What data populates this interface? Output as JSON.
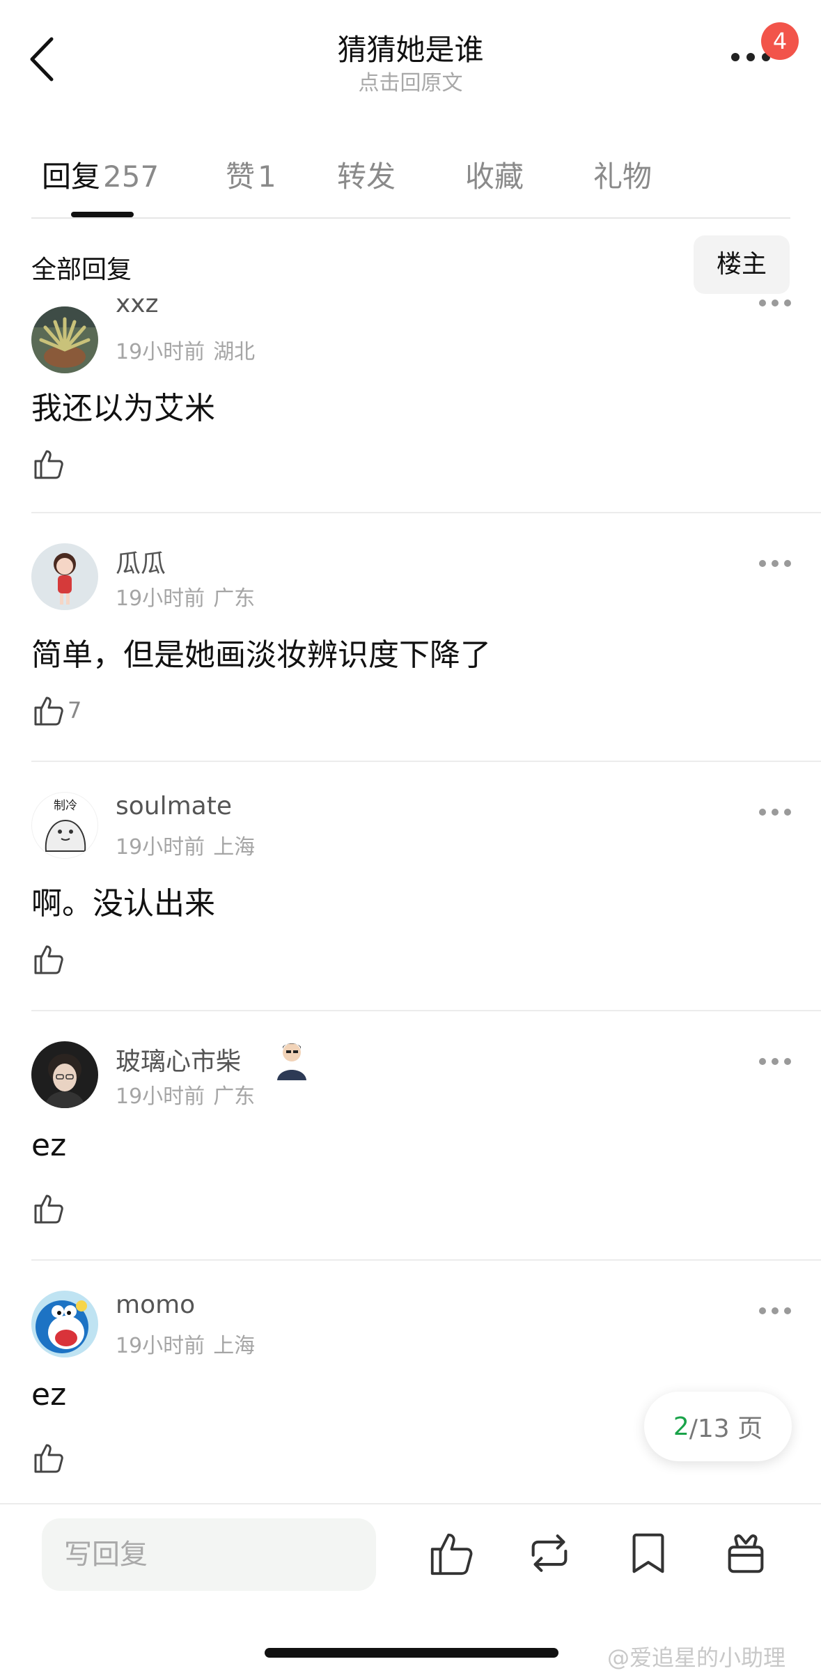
{
  "header": {
    "title": "猜猜她是谁",
    "subtitle": "点击回原文",
    "notification_badge": "4"
  },
  "tabs": [
    {
      "label": "回复",
      "count": "257",
      "active": true
    },
    {
      "label": "赞",
      "count": "1",
      "active": false
    },
    {
      "label": "转发",
      "count": "",
      "active": false
    },
    {
      "label": "收藏",
      "count": "",
      "active": false
    },
    {
      "label": "礼物",
      "count": "",
      "active": false
    }
  ],
  "filter": {
    "all_replies_label": "全部回复",
    "op_only_label": "楼主"
  },
  "comments": [
    {
      "username": "xxz",
      "time": "19小时前",
      "location": "湖北",
      "text": "我还以为艾米",
      "likes": ""
    },
    {
      "username": "瓜瓜",
      "time": "19小时前",
      "location": "广东",
      "text": "简单，但是她画淡妆辨识度下降了",
      "likes": "7"
    },
    {
      "username": "soulmate",
      "time": "19小时前",
      "location": "上海",
      "text": "啊。没认出来",
      "likes": "",
      "avatar_text": "制冷"
    },
    {
      "username": "玻璃心市柴",
      "time": "19小时前",
      "location": "广东",
      "text": "ez",
      "likes": ""
    },
    {
      "username": "momo",
      "time": "19小时前",
      "location": "上海",
      "text": "ez",
      "likes": ""
    }
  ],
  "pager": {
    "current": "2",
    "total_text": "/13 页"
  },
  "bottom_bar": {
    "reply_placeholder": "写回复",
    "icons": [
      "like-icon",
      "repost-icon",
      "bookmark-icon",
      "gift-icon"
    ]
  },
  "watermark": "@爱追星的小助理",
  "colors": {
    "badge": "#f2544a",
    "pager_current": "#1aa34a"
  }
}
